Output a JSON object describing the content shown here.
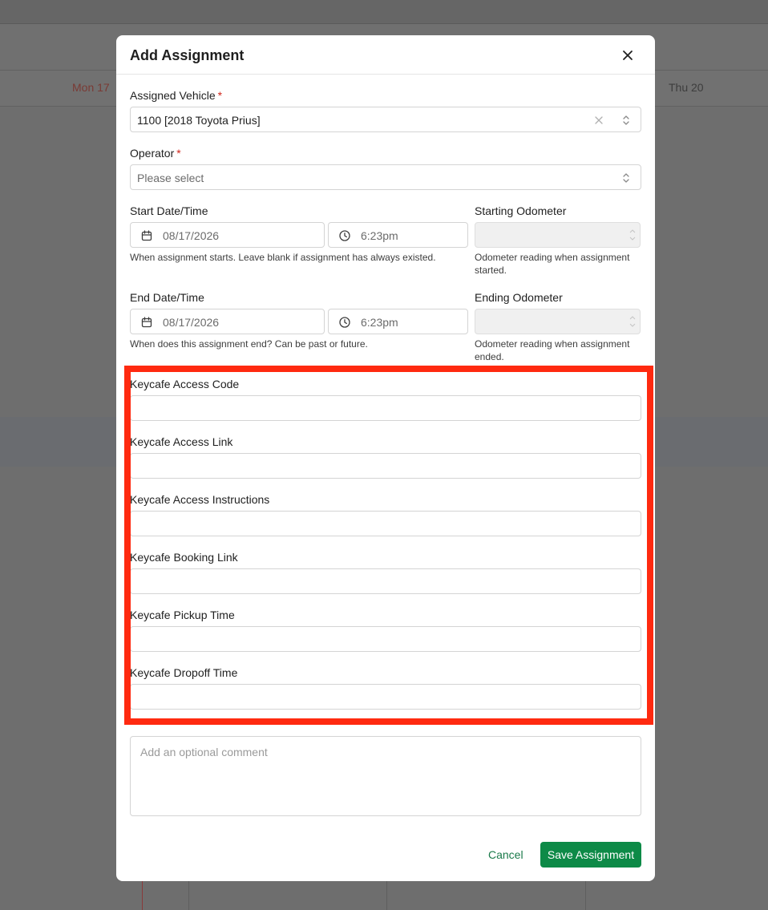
{
  "background": {
    "days": [
      {
        "label": "Mon 17"
      },
      {
        "label": "Thu 20"
      }
    ]
  },
  "modal": {
    "title": "Add Assignment",
    "close_icon": "close-icon",
    "vehicle": {
      "label": "Assigned Vehicle",
      "required_mark": "*",
      "value": "1100 [2018 Toyota Prius]"
    },
    "operator": {
      "label": "Operator",
      "required_mark": "*",
      "placeholder": "Please select"
    },
    "start": {
      "label": "Start Date/Time",
      "date": "08/17/2026",
      "time": "6:23pm",
      "help": "When assignment starts. Leave blank if assignment has always existed."
    },
    "starting_odometer": {
      "label": "Starting Odometer",
      "help_line1": "Odometer reading when assignment",
      "help_line2": "started."
    },
    "end": {
      "label": "End Date/Time",
      "date": "08/17/2026",
      "time": "6:23pm",
      "help": "When does this assignment end? Can be past or future."
    },
    "ending_odometer": {
      "label": "Ending Odometer",
      "help_line1": "Odometer reading when assignment",
      "help_line2": "ended."
    },
    "keycafe_fields": [
      {
        "label": "Keycafe Access Code",
        "value": ""
      },
      {
        "label": "Keycafe Access Link",
        "value": ""
      },
      {
        "label": "Keycafe Access Instructions",
        "value": ""
      },
      {
        "label": "Keycafe Booking Link",
        "value": ""
      },
      {
        "label": "Keycafe Pickup Time",
        "value": ""
      },
      {
        "label": "Keycafe Dropoff Time",
        "value": ""
      }
    ],
    "comment": {
      "placeholder": "Add an optional comment"
    },
    "cancel_label": "Cancel",
    "save_label": "Save Assignment"
  },
  "colors": {
    "accent": "#0d8a47",
    "required": "#d0261c",
    "highlight": "#ff2a10"
  }
}
